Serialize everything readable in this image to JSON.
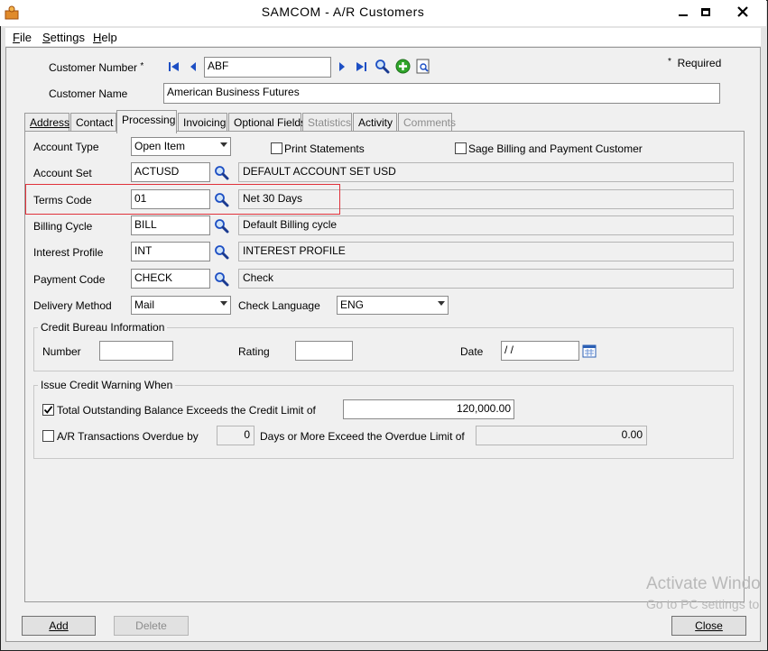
{
  "window": {
    "title": "SAMCOM - A/R Customers"
  },
  "menu": [
    {
      "label": "File",
      "u": "F",
      "rest": "ile"
    },
    {
      "label": "Settings",
      "u": "S",
      "rest": "ettings"
    },
    {
      "label": "Help",
      "u": "H",
      "rest": "elp"
    }
  ],
  "header": {
    "customer_number_label": "Customer Number",
    "required_marker": "*",
    "customer_number": "ABF",
    "customer_name_label": "Customer Name",
    "customer_name": "American Business Futures",
    "required_note": "Required"
  },
  "tabs": [
    "Address",
    "Contact",
    "Processing",
    "Invoicing",
    "Optional Fields",
    "Statistics",
    "Activity",
    "Comments"
  ],
  "processing": {
    "account_type_label": "Account Type",
    "account_type": "Open Item",
    "print_statements_label": "Print Statements",
    "sage_billing_label": "Sage Billing and Payment Customer",
    "account_set_label": "Account Set",
    "account_set": "ACTUSD",
    "account_set_desc": "DEFAULT ACCOUNT SET USD",
    "terms_code_label": "Terms Code",
    "terms_code": "01",
    "terms_code_desc": "Net 30 Days",
    "billing_cycle_label": "Billing Cycle",
    "billing_cycle": "BILL",
    "billing_cycle_desc": "Default Billing cycle",
    "interest_profile_label": "Interest Profile",
    "interest_profile": "INT",
    "interest_profile_desc": "INTEREST PROFILE",
    "payment_code_label": "Payment Code",
    "payment_code": "CHECK",
    "payment_code_desc": "Check",
    "delivery_method_label": "Delivery Method",
    "delivery_method": "Mail",
    "check_language_label": "Check Language",
    "check_language": "ENG"
  },
  "credit_bureau": {
    "title": "Credit Bureau Information",
    "number_label": "Number",
    "number": "",
    "rating_label": "Rating",
    "rating": "",
    "date_label": "Date",
    "date": " / /"
  },
  "credit_warning": {
    "title": "Issue Credit Warning When",
    "total_balance_label": "Total Outstanding Balance Exceeds the Credit Limit of",
    "credit_limit": "120,000.00",
    "overdue_label": "A/R Transactions Overdue by",
    "overdue_days": "0",
    "overdue_days_label": "Days or More Exceed the Overdue Limit of",
    "overdue_limit": "0.00"
  },
  "buttons": {
    "add": "Add",
    "delete": "Delete",
    "close": "Close"
  },
  "watermark": {
    "line1": "Activate Windo",
    "line2": "Go to PC settings to"
  },
  "colors": {
    "highlight": "#e0313a",
    "nav_blue": "#1d4fc4",
    "add_green": "#2fa52a"
  }
}
